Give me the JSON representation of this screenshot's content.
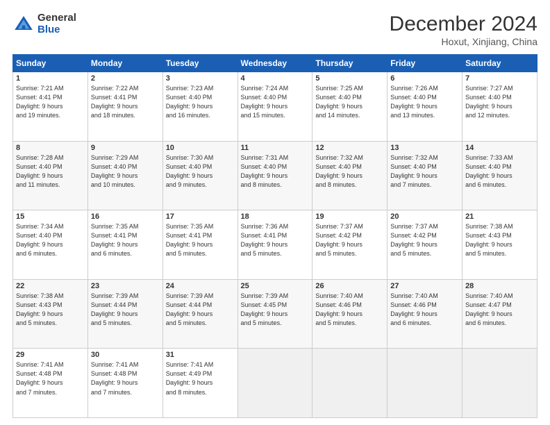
{
  "header": {
    "logo_general": "General",
    "logo_blue": "Blue",
    "month_title": "December 2024",
    "location": "Hoxut, Xinjiang, China"
  },
  "weekdays": [
    "Sunday",
    "Monday",
    "Tuesday",
    "Wednesday",
    "Thursday",
    "Friday",
    "Saturday"
  ],
  "weeks": [
    [
      {
        "day": 1,
        "detail": "Sunrise: 7:21 AM\nSunset: 4:41 PM\nDaylight: 9 hours\nand 19 minutes."
      },
      {
        "day": 2,
        "detail": "Sunrise: 7:22 AM\nSunset: 4:41 PM\nDaylight: 9 hours\nand 18 minutes."
      },
      {
        "day": 3,
        "detail": "Sunrise: 7:23 AM\nSunset: 4:40 PM\nDaylight: 9 hours\nand 16 minutes."
      },
      {
        "day": 4,
        "detail": "Sunrise: 7:24 AM\nSunset: 4:40 PM\nDaylight: 9 hours\nand 15 minutes."
      },
      {
        "day": 5,
        "detail": "Sunrise: 7:25 AM\nSunset: 4:40 PM\nDaylight: 9 hours\nand 14 minutes."
      },
      {
        "day": 6,
        "detail": "Sunrise: 7:26 AM\nSunset: 4:40 PM\nDaylight: 9 hours\nand 13 minutes."
      },
      {
        "day": 7,
        "detail": "Sunrise: 7:27 AM\nSunset: 4:40 PM\nDaylight: 9 hours\nand 12 minutes."
      }
    ],
    [
      {
        "day": 8,
        "detail": "Sunrise: 7:28 AM\nSunset: 4:40 PM\nDaylight: 9 hours\nand 11 minutes."
      },
      {
        "day": 9,
        "detail": "Sunrise: 7:29 AM\nSunset: 4:40 PM\nDaylight: 9 hours\nand 10 minutes."
      },
      {
        "day": 10,
        "detail": "Sunrise: 7:30 AM\nSunset: 4:40 PM\nDaylight: 9 hours\nand 9 minutes."
      },
      {
        "day": 11,
        "detail": "Sunrise: 7:31 AM\nSunset: 4:40 PM\nDaylight: 9 hours\nand 8 minutes."
      },
      {
        "day": 12,
        "detail": "Sunrise: 7:32 AM\nSunset: 4:40 PM\nDaylight: 9 hours\nand 8 minutes."
      },
      {
        "day": 13,
        "detail": "Sunrise: 7:32 AM\nSunset: 4:40 PM\nDaylight: 9 hours\nand 7 minutes."
      },
      {
        "day": 14,
        "detail": "Sunrise: 7:33 AM\nSunset: 4:40 PM\nDaylight: 9 hours\nand 6 minutes."
      }
    ],
    [
      {
        "day": 15,
        "detail": "Sunrise: 7:34 AM\nSunset: 4:40 PM\nDaylight: 9 hours\nand 6 minutes."
      },
      {
        "day": 16,
        "detail": "Sunrise: 7:35 AM\nSunset: 4:41 PM\nDaylight: 9 hours\nand 6 minutes."
      },
      {
        "day": 17,
        "detail": "Sunrise: 7:35 AM\nSunset: 4:41 PM\nDaylight: 9 hours\nand 5 minutes."
      },
      {
        "day": 18,
        "detail": "Sunrise: 7:36 AM\nSunset: 4:41 PM\nDaylight: 9 hours\nand 5 minutes."
      },
      {
        "day": 19,
        "detail": "Sunrise: 7:37 AM\nSunset: 4:42 PM\nDaylight: 9 hours\nand 5 minutes."
      },
      {
        "day": 20,
        "detail": "Sunrise: 7:37 AM\nSunset: 4:42 PM\nDaylight: 9 hours\nand 5 minutes."
      },
      {
        "day": 21,
        "detail": "Sunrise: 7:38 AM\nSunset: 4:43 PM\nDaylight: 9 hours\nand 5 minutes."
      }
    ],
    [
      {
        "day": 22,
        "detail": "Sunrise: 7:38 AM\nSunset: 4:43 PM\nDaylight: 9 hours\nand 5 minutes."
      },
      {
        "day": 23,
        "detail": "Sunrise: 7:39 AM\nSunset: 4:44 PM\nDaylight: 9 hours\nand 5 minutes."
      },
      {
        "day": 24,
        "detail": "Sunrise: 7:39 AM\nSunset: 4:44 PM\nDaylight: 9 hours\nand 5 minutes."
      },
      {
        "day": 25,
        "detail": "Sunrise: 7:39 AM\nSunset: 4:45 PM\nDaylight: 9 hours\nand 5 minutes."
      },
      {
        "day": 26,
        "detail": "Sunrise: 7:40 AM\nSunset: 4:46 PM\nDaylight: 9 hours\nand 5 minutes."
      },
      {
        "day": 27,
        "detail": "Sunrise: 7:40 AM\nSunset: 4:46 PM\nDaylight: 9 hours\nand 6 minutes."
      },
      {
        "day": 28,
        "detail": "Sunrise: 7:40 AM\nSunset: 4:47 PM\nDaylight: 9 hours\nand 6 minutes."
      }
    ],
    [
      {
        "day": 29,
        "detail": "Sunrise: 7:41 AM\nSunset: 4:48 PM\nDaylight: 9 hours\nand 7 minutes."
      },
      {
        "day": 30,
        "detail": "Sunrise: 7:41 AM\nSunset: 4:48 PM\nDaylight: 9 hours\nand 7 minutes."
      },
      {
        "day": 31,
        "detail": "Sunrise: 7:41 AM\nSunset: 4:49 PM\nDaylight: 9 hours\nand 8 minutes."
      },
      null,
      null,
      null,
      null
    ]
  ]
}
